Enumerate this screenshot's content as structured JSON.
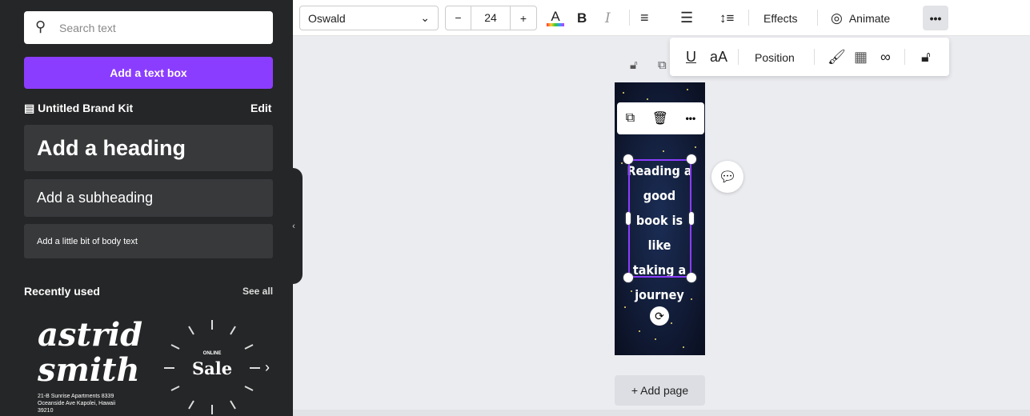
{
  "sidebar": {
    "search_placeholder": "Search text",
    "add_text_box": "Add a text box",
    "brand_kit": "Untitled Brand Kit",
    "edit": "Edit",
    "heading": "Add a heading",
    "subheading": "Add a subheading",
    "body": "Add a little bit of body text",
    "recently_used": "Recently used",
    "see_all": "See all",
    "recent": [
      {
        "title1": "astrid",
        "title2": "smith",
        "address": "21-B Sunrise Apartments 8339 Oceanside Ave Kapolei, Hawaii 39210"
      },
      {
        "top": "ONLINE",
        "title": "Sale"
      }
    ]
  },
  "toolbar": {
    "font": "Oswald",
    "font_size": "24",
    "minus": "−",
    "plus": "+",
    "bold": "B",
    "italic": "I",
    "effects": "Effects",
    "animate": "Animate",
    "more": "•••"
  },
  "subtoolbar": {
    "underline": "U",
    "case": "aA",
    "position": "Position"
  },
  "canvas": {
    "text": "Reading a good book is like taking a journey",
    "add_page": "+ Add page",
    "context_more": "•••"
  }
}
